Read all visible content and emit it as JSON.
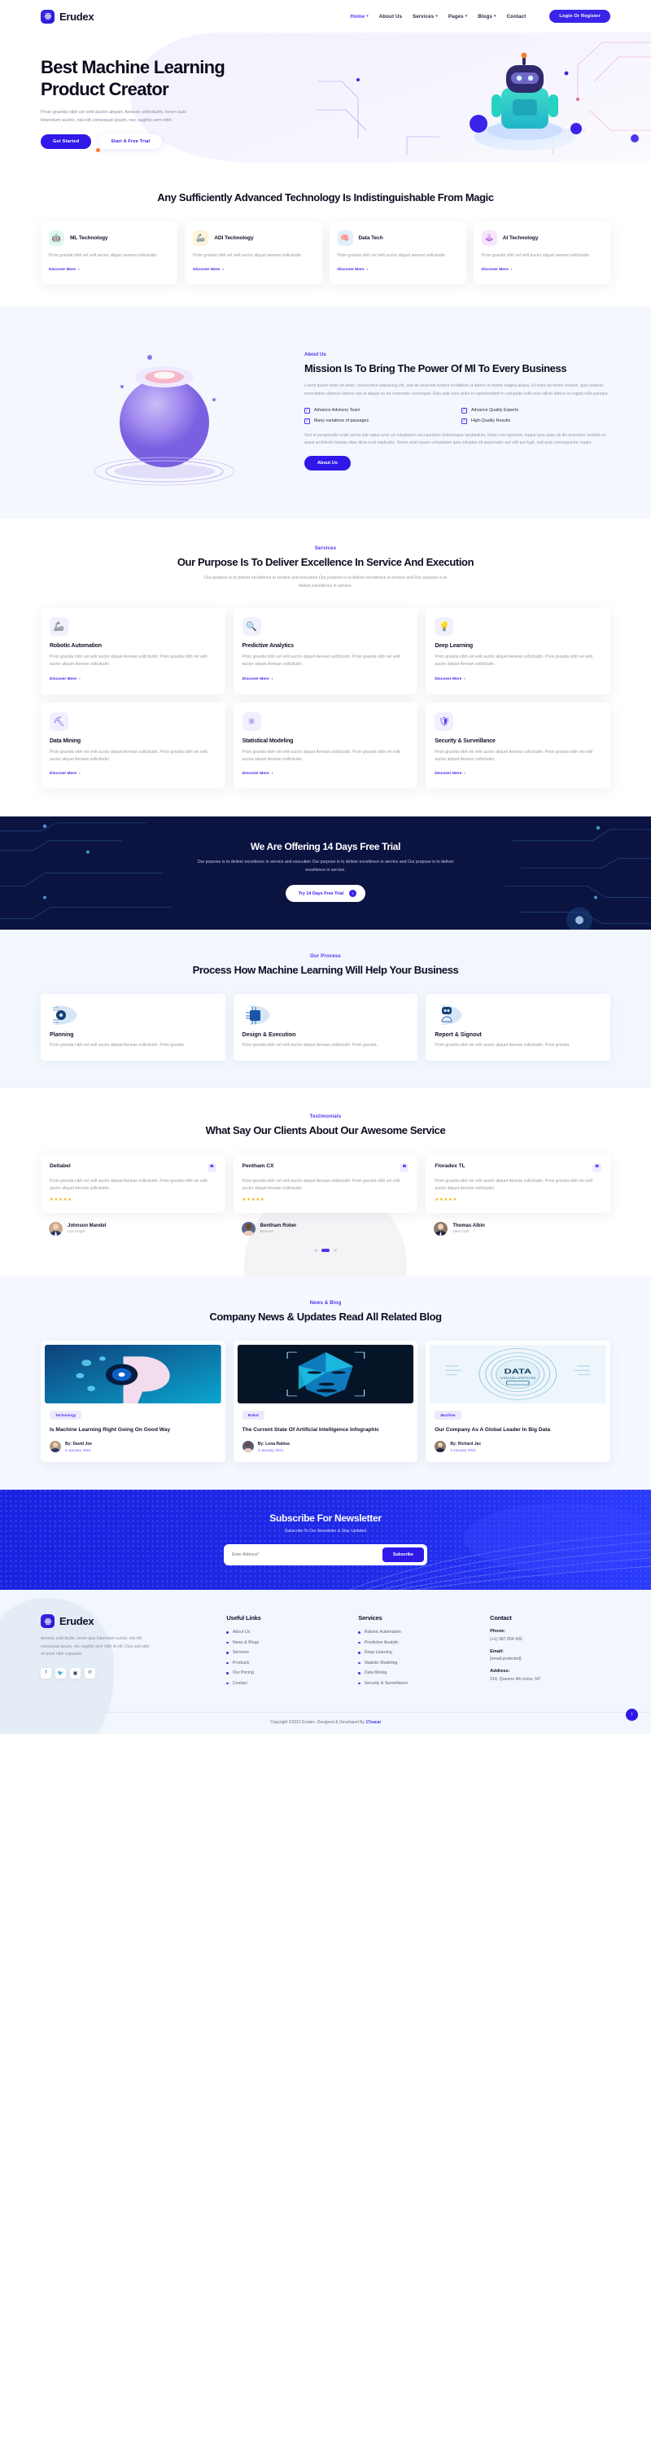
{
  "brand": {
    "name": "Erudex",
    "icon": "atom-icon"
  },
  "nav": {
    "items": [
      {
        "label": "Home",
        "caret": true,
        "active": true
      },
      {
        "label": "About Us",
        "caret": false,
        "active": false
      },
      {
        "label": "Services",
        "caret": true,
        "active": false
      },
      {
        "label": "Pages",
        "caret": true,
        "active": false
      },
      {
        "label": "Blogs",
        "caret": true,
        "active": false
      },
      {
        "label": "Contact",
        "caret": false,
        "active": false
      }
    ],
    "login_label": "Login Or Register"
  },
  "hero": {
    "title": "Best Machine Learning Product Creator",
    "text": "Proin gravida nibh vel velit auctor aliquet. Aenean sollicitudin, lorem quis bibendum auctor, nisi elit consequat ipsum, nec sagittis sem nibh",
    "primary_btn": "Get Started",
    "secondary_btn": "Start A Free Trial"
  },
  "tech": {
    "title": "Any Sufficiently Advanced Technology Is Indistinguishable From Magic",
    "cards": [
      {
        "name": "ML Technology",
        "text": "Proin gravida nibh vel velit auctor aliquet aenean sollicitudin.",
        "link": "Discover More",
        "icon": "robot-icon",
        "bg": "#e2f7ec",
        "fg": "#2bb789"
      },
      {
        "name": "ADI Technology",
        "text": "Proin gravida nibh vel velit auctor aliquet aenean sollicitudin.",
        "link": "Discover More",
        "icon": "arm-icon",
        "bg": "#fdf3d8",
        "fg": "#e0ae2a"
      },
      {
        "name": "Data Tech",
        "text": "Proin gravida nibh vel velit auctor aliquet aenean sollicitudin.",
        "link": "Discover More",
        "icon": "brain-icon",
        "bg": "#e1effb",
        "fg": "#4d8ede"
      },
      {
        "name": "AI Technology",
        "text": "Proin gravida nibh vel velit auctor aliquet aenean sollicitudin.",
        "link": "Discover More",
        "icon": "chip-icon",
        "bg": "#f6e6fb",
        "fg": "#b95ed8"
      }
    ]
  },
  "about": {
    "label": "About Us",
    "title": "Mission Is To Bring The Power Of Ml To Every Business",
    "p1": "Lorem ipsum dolor sit amet, consectetur adipiscing elit, sed do eiusmod tempor incididunt ut labore et dolore magna aliqua. Ut enim ad minim veniam, quis nostrud exercitation ullamco laboris nisi ut aliquip ex ea commodo consequat. Duis aute irure dolor in reprehenderit in voluptate velit esse cillum dolore eu fugiat nulla pariatur.",
    "features": [
      "Advance Advisory Team",
      "Advance Quality Experts",
      "Many variations of passages",
      "High-Quality Results"
    ],
    "p2": "Sed ut perspiciatis unde omnis iste natus error sit voluptatem accusantium doloremque laudantium, totam rem aperiam, eaque ipsa quae ab illo inventore veritatis et quasi architecto beatae vitae dicta sunt explicabo. Nemo enim ipsam voluptatem quia voluptas sit aspernatur aut odit aut fugit, sed quia consequuntur magni.",
    "btn": "About Us"
  },
  "services": {
    "label": "Services",
    "title": "Our Purpose Is To Deliver Excellence In Service And Execution",
    "sub": "Our purpose is to deliver excellence in service and execution Our purpose is to deliver excellence in service and Our purpose is to deliver excellence in service.",
    "cards": [
      {
        "name": "Robotic Automation",
        "text": "Proin gravida nibh vel velit auctor aliquet Aenean sollicitudin. Proin gravida nibh vel velit auctor aliquet Aenean sollicitudin.",
        "link": "Discover More",
        "icon": "robot-arm-icon"
      },
      {
        "name": "Predictive Analytics",
        "text": "Proin gravida nibh vel velit auctor aliquet Aenean sollicitudin. Proin gravida nibh vel velit auctor aliquet Aenean sollicitudin.",
        "link": "Discover More",
        "icon": "chart-magnifier-icon"
      },
      {
        "name": "Deep Learning",
        "text": "Proin gravida nibh vel velit auctor aliquet Aenean sollicitudin. Proin gravida nibh vel velit auctor aliquet Aenean sollicitudin.",
        "link": "Discover More",
        "icon": "neural-bulb-icon"
      },
      {
        "name": "Data Mining",
        "text": "Proin gravida nibh vel velit auctor aliquet Aenean sollicitudin. Proin gravida nibh vel velit auctor aliquet Aenean sollicitudin.",
        "link": "Discover More",
        "icon": "pickaxe-database-icon"
      },
      {
        "name": "Statistical Modeling",
        "text": "Proin gravida nibh vel velit auctor aliquet Aenean sollicitudin. Proin gravida nibh vel velit auctor aliquet Aenean sollicitudin.",
        "link": "Discover More",
        "icon": "network-nodes-icon"
      },
      {
        "name": "Security & Surveillance",
        "text": "Proin gravida nibh vel velit auctor aliquet Aenean sollicitudin. Proin gravida nibh vel velit auctor aliquet Aenean sollicitudin.",
        "link": "Discover More",
        "icon": "shield-camera-icon"
      }
    ]
  },
  "trial": {
    "title": "We Are Offering 14 Days Free Trial",
    "sub": "Our purpose is to deliver excellence in service and execution Our purpose is to deliver excellence in service and Our purpose is to deliver excellence in service.",
    "btn": "Try 14 Days Free Trial"
  },
  "process": {
    "label": "Our Process",
    "title": "Process How Machine Learning Will Help Your Business",
    "cards": [
      {
        "name": "Planning",
        "text": "Proin gravida nibh vel velit auctor aliquet Aenean sollicitudin. Proin gravida.",
        "icon": "eye-circuit-icon"
      },
      {
        "name": "Design & Execution",
        "text": "Proin gravida nibh vel velit auctor aliquet Aenean sollicitudin. Proin gravida.",
        "icon": "chip-icon"
      },
      {
        "name": "Report & Signout",
        "text": "Proin gravida nibh vel velit auctor aliquet Aenean sollicitudin. Proin gravida.",
        "icon": "robot-icon"
      }
    ]
  },
  "testimonials": {
    "label": "Testimonials",
    "title": "What Say Our Clients About Our Awesome Service",
    "cards": [
      {
        "company": "Deltabel",
        "text": "Proin gravida nibh vel velit auctor aliquet Aenean sollicitudin. Proin gravida nibh vel velit auctor aliquet Aenean sollicitudin.",
        "stars": "★★★★★",
        "name": "Johnson Mandel",
        "location": "Los Angel"
      },
      {
        "company": "Pentham CX",
        "text": "Proin gravida nibh vel velit auctor aliquet Aenean sollicitudin. Proin gravida nibh vel velit auctor aliquet Aenean sollicitudin.",
        "stars": "★★★★★",
        "name": "Bentham Rober",
        "location": "Bremen"
      },
      {
        "company": "Floradex TL",
        "text": "Proin gravida nibh vel velit auctor aliquet Aenean sollicitudin. Proin gravida nibh vel velit auctor aliquet Aenean sollicitudin.",
        "stars": "★★★★★",
        "name": "Thomas Albin",
        "location": "New York"
      }
    ]
  },
  "blog": {
    "label": "News & Blog",
    "title": "Company News & Updates Read All Related Blog",
    "posts": [
      {
        "tag": "Technology",
        "title": "Is Machine Learning Right Going On Good Way",
        "author": "By: David Joe",
        "date": "5 January 2021"
      },
      {
        "tag": "Robot",
        "title": "The Current State Of Artificial Intelligence Infographic",
        "author": "By: Lona Rabisa",
        "date": "4 January 2021"
      },
      {
        "tag": "Machine",
        "title": "Our Company As A Global Leader In Big Data",
        "author": "By: Richard Jac",
        "date": "3 January 2021"
      }
    ]
  },
  "newsletter": {
    "title": "Subscribe For Newsletter",
    "sub": "Subscribe To Our Newsletter & Stay Updated",
    "placeholder": "Enter Address*",
    "btn": "Subscribe"
  },
  "footer": {
    "about": "Aenean sollicitudin, lorem quis bibendum auctor, nisi elit consequat ipsum, nec sagittis sem nibh id elit. Duis sed odio sit amet nibh vulputate.",
    "socials": [
      "facebook-icon",
      "twitter-icon",
      "instagram-icon",
      "pinterest-icon"
    ],
    "useful": {
      "heading": "Useful Links",
      "items": [
        "About Us",
        "News & Blogs",
        "Services",
        "Products",
        "Our Pricing",
        "Contact"
      ]
    },
    "services": {
      "heading": "Services",
      "items": [
        "Robotic Automation",
        "Predictive Analytic",
        "Deep Learning",
        "Statistic Modeling",
        "Data Mining",
        "Security & Surveillance"
      ]
    },
    "contact": {
      "heading": "Contact",
      "phone_label": "Phone:",
      "phone": "(+1) 987 654 432",
      "email_label": "Email:",
      "email": "[email protected]",
      "address_label": "Address:",
      "address": "214, Queens 4th cross, NY"
    },
    "copyright_pre": "Copyright ©2021 Erudex. Designed & Developed By ",
    "copyright_link": "17sucai"
  },
  "colors": {
    "accent": "#3a24e8",
    "dark": "#0b1340",
    "light_bg": "#f2f6fd"
  }
}
